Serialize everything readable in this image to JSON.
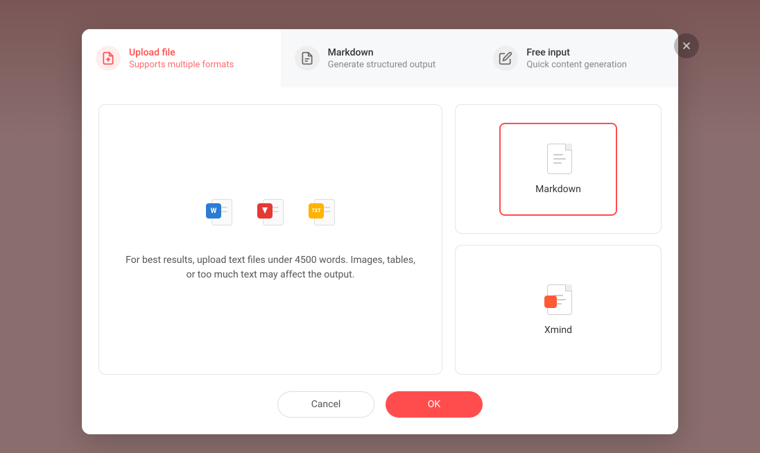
{
  "tabs": {
    "upload": {
      "title": "Upload file",
      "sub": "Supports multiple formats"
    },
    "markdown": {
      "title": "Markdown",
      "sub": "Generate structured output"
    },
    "freeinput": {
      "title": "Free input",
      "sub": "Quick content generation"
    }
  },
  "upload_panel": {
    "hint": "For best results, upload text files under 4500 words. Images, tables, or too much text may affect the output.",
    "formats": {
      "word": "W",
      "pdf": "▲",
      "txt": "TXT"
    }
  },
  "options": {
    "markdown": "Markdown",
    "xmind": "Xmind"
  },
  "footer": {
    "cancel": "Cancel",
    "ok": "OK"
  }
}
